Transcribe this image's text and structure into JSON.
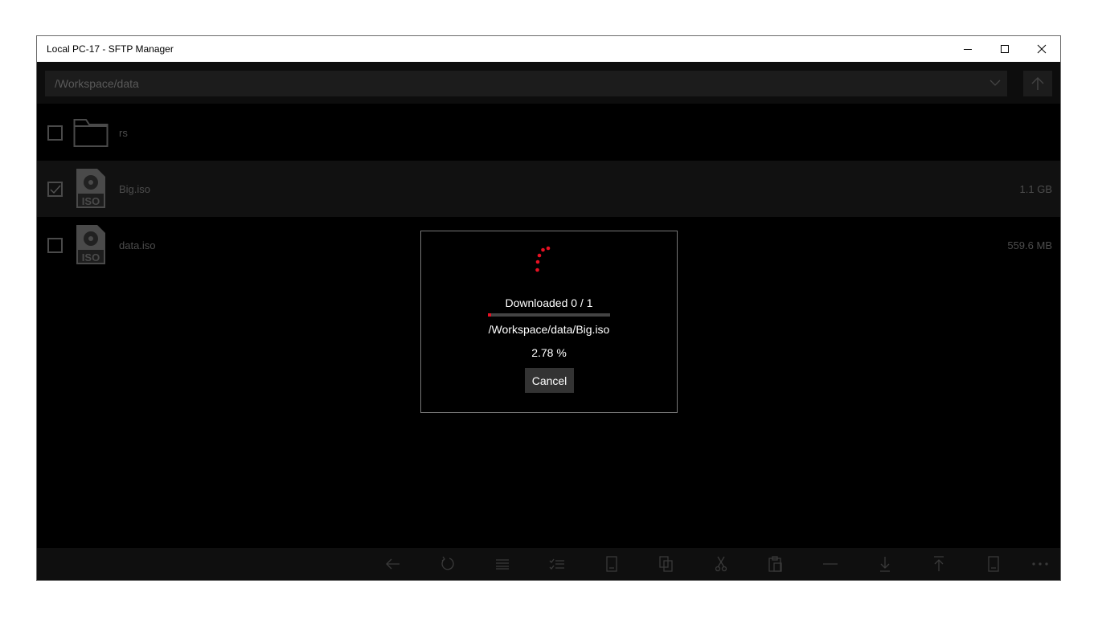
{
  "window": {
    "title": "Local PC-17 - SFTP Manager"
  },
  "path": {
    "value": "/Workspace/data"
  },
  "files": [
    {
      "name": "rs",
      "type": "folder",
      "size": "",
      "checked": false
    },
    {
      "name": "Big.iso",
      "type": "iso",
      "size": "1.1 GB",
      "checked": true
    },
    {
      "name": "data.iso",
      "type": "iso",
      "size": "559.6 MB",
      "checked": false
    }
  ],
  "iso_badge": "ISO",
  "dialog": {
    "status": "Downloaded 0 / 1",
    "file_path": "/Workspace/data/Big.iso",
    "percent_text": "2.78 %",
    "progress_fraction": 0.0278,
    "cancel_label": "Cancel"
  },
  "toolbar": {
    "icons": [
      "back-icon",
      "refresh-icon",
      "list-icon",
      "select-all-icon",
      "new-file-icon",
      "copy-icon",
      "cut-icon",
      "paste-icon",
      "delete-icon",
      "download-icon",
      "upload-icon",
      "rename-icon",
      "more-icon"
    ]
  },
  "colors": {
    "accent": "#e81123",
    "background": "#000000",
    "selected_row": "#111111"
  }
}
